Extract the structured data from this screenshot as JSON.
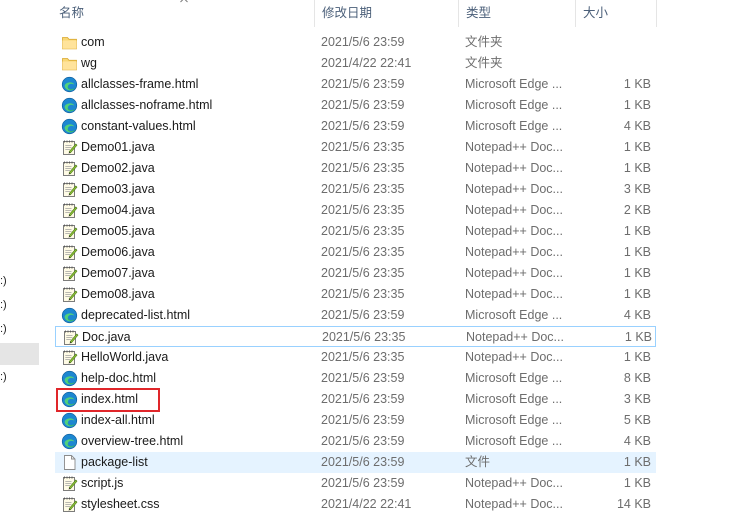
{
  "nav": {
    "items": [
      ":)",
      ":)",
      ":)",
      "",
      ":)"
    ]
  },
  "header": {
    "name": "名称",
    "date": "修改日期",
    "type": "类型",
    "size": "大小"
  },
  "files": [
    {
      "name": "com",
      "date": "2021/5/6 23:59",
      "type": "文件夹",
      "size": "",
      "icon": "folder-icon"
    },
    {
      "name": "wg",
      "date": "2021/4/22 22:41",
      "type": "文件夹",
      "size": "",
      "icon": "folder-icon"
    },
    {
      "name": "allclasses-frame.html",
      "date": "2021/5/6 23:59",
      "type": "Microsoft Edge ...",
      "size": "1 KB",
      "icon": "edge-icon"
    },
    {
      "name": "allclasses-noframe.html",
      "date": "2021/5/6 23:59",
      "type": "Microsoft Edge ...",
      "size": "1 KB",
      "icon": "edge-icon"
    },
    {
      "name": "constant-values.html",
      "date": "2021/5/6 23:59",
      "type": "Microsoft Edge ...",
      "size": "4 KB",
      "icon": "edge-icon"
    },
    {
      "name": "Demo01.java",
      "date": "2021/5/6 23:35",
      "type": "Notepad++ Doc...",
      "size": "1 KB",
      "icon": "notepad-icon"
    },
    {
      "name": "Demo02.java",
      "date": "2021/5/6 23:35",
      "type": "Notepad++ Doc...",
      "size": "1 KB",
      "icon": "notepad-icon"
    },
    {
      "name": "Demo03.java",
      "date": "2021/5/6 23:35",
      "type": "Notepad++ Doc...",
      "size": "3 KB",
      "icon": "notepad-icon"
    },
    {
      "name": "Demo04.java",
      "date": "2021/5/6 23:35",
      "type": "Notepad++ Doc...",
      "size": "2 KB",
      "icon": "notepad-icon"
    },
    {
      "name": "Demo05.java",
      "date": "2021/5/6 23:35",
      "type": "Notepad++ Doc...",
      "size": "1 KB",
      "icon": "notepad-icon"
    },
    {
      "name": "Demo06.java",
      "date": "2021/5/6 23:35",
      "type": "Notepad++ Doc...",
      "size": "1 KB",
      "icon": "notepad-icon"
    },
    {
      "name": "Demo07.java",
      "date": "2021/5/6 23:35",
      "type": "Notepad++ Doc...",
      "size": "1 KB",
      "icon": "notepad-icon"
    },
    {
      "name": "Demo08.java",
      "date": "2021/5/6 23:35",
      "type": "Notepad++ Doc...",
      "size": "1 KB",
      "icon": "notepad-icon"
    },
    {
      "name": "deprecated-list.html",
      "date": "2021/5/6 23:59",
      "type": "Microsoft Edge ...",
      "size": "4 KB",
      "icon": "edge-icon"
    },
    {
      "name": "Doc.java",
      "date": "2021/5/6 23:35",
      "type": "Notepad++ Doc...",
      "size": "1 KB",
      "icon": "notepad-icon"
    },
    {
      "name": "HelloWorld.java",
      "date": "2021/5/6 23:35",
      "type": "Notepad++ Doc...",
      "size": "1 KB",
      "icon": "notepad-icon"
    },
    {
      "name": "help-doc.html",
      "date": "2021/5/6 23:59",
      "type": "Microsoft Edge ...",
      "size": "8 KB",
      "icon": "edge-icon"
    },
    {
      "name": "index.html",
      "date": "2021/5/6 23:59",
      "type": "Microsoft Edge ...",
      "size": "3 KB",
      "icon": "edge-icon"
    },
    {
      "name": "index-all.html",
      "date": "2021/5/6 23:59",
      "type": "Microsoft Edge ...",
      "size": "5 KB",
      "icon": "edge-icon"
    },
    {
      "name": "overview-tree.html",
      "date": "2021/5/6 23:59",
      "type": "Microsoft Edge ...",
      "size": "4 KB",
      "icon": "edge-icon"
    },
    {
      "name": "package-list",
      "date": "2021/5/6 23:59",
      "type": "文件",
      "size": "1 KB",
      "icon": "file-icon"
    },
    {
      "name": "script.js",
      "date": "2021/5/6 23:59",
      "type": "Notepad++ Doc...",
      "size": "1 KB",
      "icon": "notepad-icon"
    },
    {
      "name": "stylesheet.css",
      "date": "2021/4/22 22:41",
      "type": "Notepad++ Doc...",
      "size": "14 KB",
      "icon": "notepad-icon"
    }
  ],
  "state": {
    "focused_row": 14,
    "hover_row": 20,
    "highlighted_row": 17
  },
  "colors": {
    "accent_highlight": "#e0262a",
    "hover_bg": "#e5f3ff",
    "focus_border": "#99d1ff",
    "header_text": "#4c607a"
  }
}
